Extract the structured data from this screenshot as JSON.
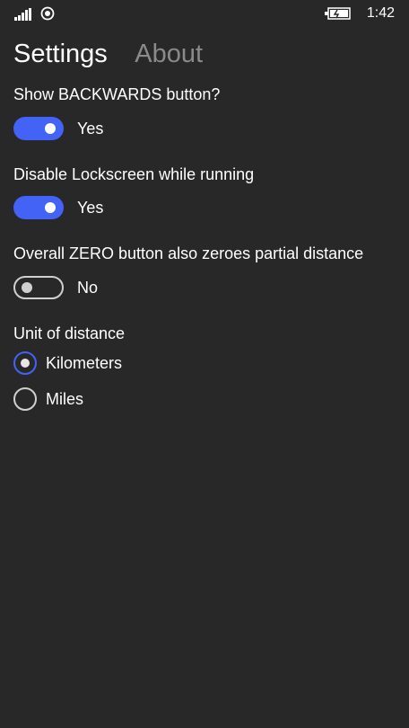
{
  "status_bar": {
    "time": "1:42",
    "icons": [
      "signal-icon",
      "wifi-icon",
      "battery-charging-icon"
    ]
  },
  "pivot": {
    "tabs": [
      {
        "label": "Settings",
        "active": true
      },
      {
        "label": "About",
        "active": false
      }
    ]
  },
  "settings": {
    "backwards": {
      "label": "Show BACKWARDS button?",
      "state_text": "Yes",
      "on": true
    },
    "lockscreen": {
      "label": "Disable Lockscreen while running",
      "state_text": "Yes",
      "on": true
    },
    "zero": {
      "label": "Overall ZERO button also zeroes partial distance",
      "state_text": "No",
      "on": false
    },
    "unit": {
      "label": "Unit of distance",
      "options": [
        {
          "label": "Kilometers",
          "selected": true
        },
        {
          "label": "Miles",
          "selected": false
        }
      ]
    }
  },
  "colors": {
    "background": "#282828",
    "accent": "#4362f6",
    "inactive_tab": "#8a8a8a"
  }
}
